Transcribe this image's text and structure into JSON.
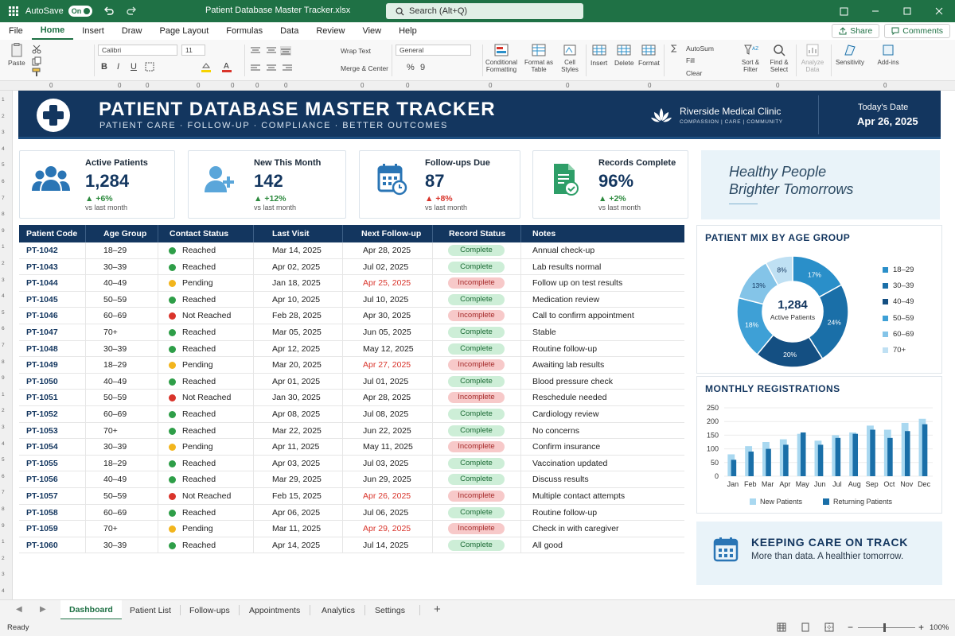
{
  "titlebar": {
    "autosave_label": "AutoSave",
    "autosave_state": "On",
    "filename": "Patient Database Master Tracker.xlsx",
    "search_placeholder": "Search (Alt+Q)"
  },
  "menu": {
    "tabs": [
      "File",
      "Home",
      "Insert",
      "Draw",
      "Page Layout",
      "Formulas",
      "Data",
      "Review",
      "View",
      "Help"
    ],
    "active": "Home",
    "share": "Share",
    "comments": "Comments"
  },
  "ribbon": {
    "paste": "Paste",
    "font_name": "Calibri",
    "font_size": "11",
    "wrap_text": "Wrap Text",
    "merge_center": "Merge & Center",
    "number_format": "General",
    "conditional_formatting": "Conditional Formatting",
    "format_as_table": "Format as Table",
    "cell_styles": "Cell Styles",
    "insert": "Insert",
    "delete": "Delete",
    "format": "Format",
    "autosum": "AutoSum",
    "fill": "Fill",
    "clear": "Clear",
    "sort_filter": "Sort & Filter",
    "find_select": "Find & Select",
    "analyze": "Analyze Data",
    "sensitivity": "Sensitivity",
    "addins": "Add-ins"
  },
  "banner": {
    "title": "PATIENT DATABASE MASTER TRACKER",
    "subtitle": "PATIENT CARE  ·  FOLLOW-UP  ·  COMPLIANCE  ·  BETTER OUTCOMES",
    "clinic": "Riverside Medical Clinic",
    "clinic_tag": "COMPASSION  |  CARE  |  COMMUNITY",
    "date_label": "Today's Date",
    "date_value": "Apr 26, 2025"
  },
  "kpis": [
    {
      "label": "Active Patients",
      "value": "1,284",
      "change": "+6%",
      "vs": "vs last month",
      "icon": "people-icon"
    },
    {
      "label": "New This Month",
      "value": "142",
      "change": "+12%",
      "vs": "vs last month",
      "icon": "add-user-icon"
    },
    {
      "label": "Follow-ups Due",
      "value": "87",
      "change": "+8%",
      "vs": "vs last month",
      "icon": "calendar-clock-icon"
    },
    {
      "label": "Records Complete",
      "value": "96%",
      "change": "+2%",
      "vs": "vs last month",
      "icon": "document-check-icon"
    }
  ],
  "quote": {
    "line1": "Healthy People",
    "line2": "Brighter Tomorrows"
  },
  "table": {
    "columns": [
      "Patient Code",
      "Age Group",
      "Contact Status",
      "Last Visit",
      "Next Follow-up",
      "Record Status",
      "Notes"
    ],
    "rows": [
      {
        "code": "PT-1042",
        "age": "18–29",
        "contact": "Reached",
        "last": "Mar 14, 2025",
        "next": "Apr 28, 2025",
        "record": "Complete",
        "notes": "Annual check-up"
      },
      {
        "code": "PT-1043",
        "age": "30–39",
        "contact": "Reached",
        "last": "Apr 02, 2025",
        "next": "Jul 02, 2025",
        "record": "Complete",
        "notes": "Lab results normal"
      },
      {
        "code": "PT-1044",
        "age": "40–49",
        "contact": "Pending",
        "last": "Jan 18, 2025",
        "next": "Apr 25, 2025",
        "record": "Incomplete",
        "notes": "Follow up on test results"
      },
      {
        "code": "PT-1045",
        "age": "50–59",
        "contact": "Reached",
        "last": "Apr 10, 2025",
        "next": "Jul 10, 2025",
        "record": "Complete",
        "notes": "Medication review"
      },
      {
        "code": "PT-1046",
        "age": "60–69",
        "contact": "Not Reached",
        "last": "Feb 28, 2025",
        "next": "Apr 30, 2025",
        "record": "Incomplete",
        "notes": "Call to confirm appointment"
      },
      {
        "code": "PT-1047",
        "age": "70+",
        "contact": "Reached",
        "last": "Mar 05, 2025",
        "next": "Jun 05, 2025",
        "record": "Complete",
        "notes": "Stable"
      },
      {
        "code": "PT-1048",
        "age": "30–39",
        "contact": "Reached",
        "last": "Apr 12, 2025",
        "next": "May 12, 2025",
        "record": "Complete",
        "notes": "Routine follow-up"
      },
      {
        "code": "PT-1049",
        "age": "18–29",
        "contact": "Pending",
        "last": "Mar 20, 2025",
        "next": "Apr 27, 2025",
        "record": "Incomplete",
        "notes": "Awaiting lab results"
      },
      {
        "code": "PT-1050",
        "age": "40–49",
        "contact": "Reached",
        "last": "Apr 01, 2025",
        "next": "Jul 01, 2025",
        "record": "Complete",
        "notes": "Blood pressure check"
      },
      {
        "code": "PT-1051",
        "age": "50–59",
        "contact": "Not Reached",
        "last": "Jan 30, 2025",
        "next": "Apr 28, 2025",
        "record": "Incomplete",
        "notes": "Reschedule needed"
      },
      {
        "code": "PT-1052",
        "age": "60–69",
        "contact": "Reached",
        "last": "Apr 08, 2025",
        "next": "Jul 08, 2025",
        "record": "Complete",
        "notes": "Cardiology review"
      },
      {
        "code": "PT-1053",
        "age": "70+",
        "contact": "Reached",
        "last": "Mar 22, 2025",
        "next": "Jun 22, 2025",
        "record": "Complete",
        "notes": "No concerns"
      },
      {
        "code": "PT-1054",
        "age": "30–39",
        "contact": "Pending",
        "last": "Apr 11, 2025",
        "next": "May 11, 2025",
        "record": "Incomplete",
        "notes": "Confirm insurance"
      },
      {
        "code": "PT-1055",
        "age": "18–29",
        "contact": "Reached",
        "last": "Apr 03, 2025",
        "next": "Jul 03, 2025",
        "record": "Complete",
        "notes": "Vaccination updated"
      },
      {
        "code": "PT-1056",
        "age": "40–49",
        "contact": "Reached",
        "last": "Mar 29, 2025",
        "next": "Jun 29, 2025",
        "record": "Complete",
        "notes": "Discuss results"
      },
      {
        "code": "PT-1057",
        "age": "50–59",
        "contact": "Not Reached",
        "last": "Feb 15, 2025",
        "next": "Apr 26, 2025",
        "record": "Incomplete",
        "notes": "Multiple contact attempts"
      },
      {
        "code": "PT-1058",
        "age": "60–69",
        "contact": "Reached",
        "last": "Apr 06, 2025",
        "next": "Jul 06, 2025",
        "record": "Complete",
        "notes": "Routine follow-up"
      },
      {
        "code": "PT-1059",
        "age": "70+",
        "contact": "Pending",
        "last": "Mar 11, 2025",
        "next": "Apr 29, 2025",
        "record": "Incomplete",
        "notes": "Check in with caregiver"
      },
      {
        "code": "PT-1060",
        "age": "30–39",
        "contact": "Reached",
        "last": "Apr 14, 2025",
        "next": "Jul 14, 2025",
        "record": "Complete",
        "notes": "All good"
      }
    ],
    "overdue_next": [
      "Apr 25, 2025",
      "Apr 27, 2025",
      "Apr 26, 2025",
      "Apr 29, 2025"
    ]
  },
  "donut": {
    "title": "PATIENT MIX BY AGE GROUP",
    "center_value": "1,284",
    "center_label": "Active Patients",
    "slices": [
      {
        "label": "18–29",
        "pct": 17,
        "text": "17%",
        "color": "#2a8fc9"
      },
      {
        "label": "30–39",
        "pct": 24,
        "text": "24%",
        "color": "#1a6fa8"
      },
      {
        "label": "40–49",
        "pct": 20,
        "text": "20%",
        "color": "#144f82"
      },
      {
        "label": "50–59",
        "pct": 18,
        "text": "18%",
        "color": "#3ea0d6"
      },
      {
        "label": "60–69",
        "pct": 13,
        "text": "13%",
        "color": "#84c4e8"
      },
      {
        "label": "70+",
        "pct": 8,
        "text": "8%",
        "color": "#bfe0f3"
      }
    ],
    "legend": [
      "18–29",
      "30–39",
      "40–49",
      "50–59",
      "60–69",
      "70+"
    ]
  },
  "chart_data": {
    "type": "bar",
    "title": "MONTHLY REGISTRATIONS",
    "categories": [
      "Jan",
      "Feb",
      "Mar",
      "Apr",
      "May",
      "Jun",
      "Jul",
      "Aug",
      "Sep",
      "Oct",
      "Nov",
      "Dec"
    ],
    "series": [
      {
        "name": "New Patients",
        "values": [
          80,
          110,
          125,
          135,
          155,
          130,
          150,
          160,
          185,
          170,
          195,
          210
        ],
        "color": "#a9d8f0"
      },
      {
        "name": "Returning Patients",
        "values": [
          60,
          90,
          100,
          115,
          160,
          115,
          140,
          155,
          170,
          140,
          165,
          190
        ],
        "color": "#1a6fa8"
      }
    ],
    "ylim": [
      0,
      250
    ],
    "yticks": [
      "250",
      "200",
      "150",
      "100",
      "50",
      "0"
    ]
  },
  "care": {
    "heading": "KEEPING CARE ON TRACK",
    "sub": "More than data. A healthier tomorrow."
  },
  "sheets": {
    "tabs": [
      "Dashboard",
      "Patient List",
      "Follow-ups",
      "Appointments",
      "Analytics",
      "Settings"
    ],
    "active": "Dashboard"
  },
  "statusbar": {
    "ready": "Ready",
    "zoom": "100%"
  },
  "colors": {
    "excel_green": "#1f7145",
    "navy": "#13365f",
    "reached": "#2e9e48",
    "pending": "#f2b51d",
    "not_reached": "#d9342b",
    "complete_bg": "#cdeed7",
    "incomplete_bg": "#f7c9c9",
    "overdue": "#d9342b"
  }
}
